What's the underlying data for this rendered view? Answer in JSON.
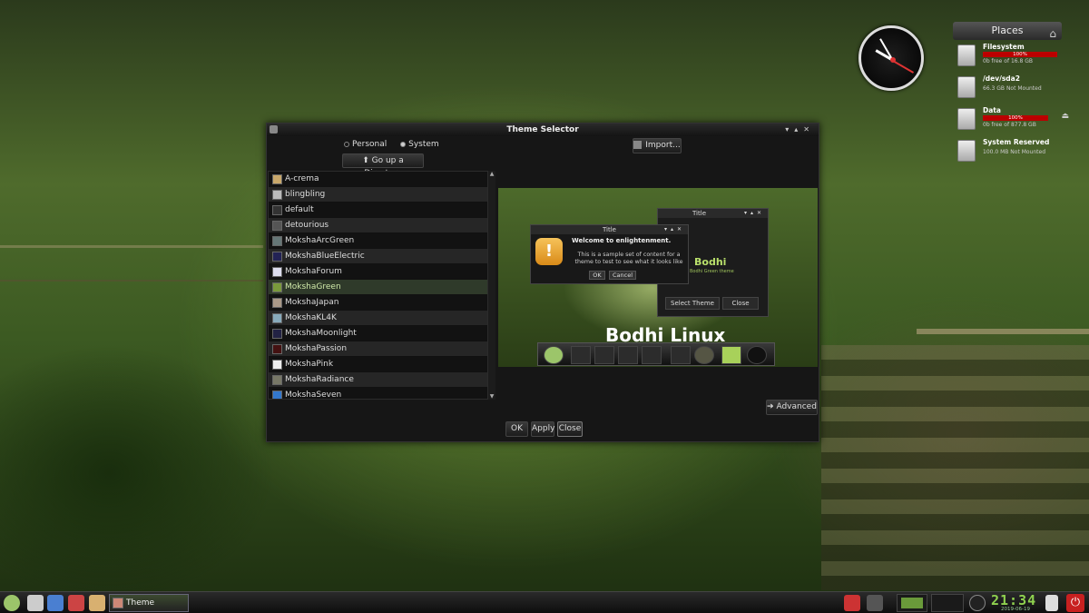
{
  "places": {
    "title": "Places",
    "drives": [
      {
        "name": "Filesystem",
        "usage": "100%",
        "info": "0b free of 16.8 GB"
      },
      {
        "name": "/dev/sda2",
        "usage": "",
        "info": "66.3 GB Not Mounted"
      },
      {
        "name": "Data",
        "usage": "100%",
        "info": "0b free of 877.8 GB"
      },
      {
        "name": "System Reserved",
        "usage": "",
        "info": "100.0 MB Not Mounted"
      }
    ]
  },
  "window": {
    "title": "Theme Selector",
    "radio_personal": "Personal",
    "radio_system": "System",
    "go_up": "Go up a Directory",
    "import": "Import...",
    "advanced": "Advanced",
    "ok": "OK",
    "apply": "Apply",
    "close": "Close",
    "themes": [
      "A-crema",
      "blingbling",
      "default",
      "detourious",
      "MokshaArcGreen",
      "MokshaBlueElectric",
      "MokshaForum",
      "MokshaGreen",
      "MokshaJapan",
      "MokshaKL4K",
      "MokshaMoonlight",
      "MokshaPassion",
      "MokshaPink",
      "MokshaRadiance",
      "MokshaSeven"
    ],
    "selected_theme": "MokshaGreen"
  },
  "preview": {
    "brand": "Bodhi Linux",
    "dialog_title": "Title",
    "dialog_heading": "Welcome to enlightenment.",
    "dialog_body": "This is a sample set of content for a theme to test to see what it looks like",
    "dialog_ok": "OK",
    "dialog_cancel": "Cancel",
    "theme_win_title": "Title",
    "theme_logo": "Bodhi",
    "theme_logo_sub": "Bodhi Green theme",
    "select_theme": "Select Theme",
    "theme_close": "Close"
  },
  "taskbar": {
    "task_label": "Theme Selector",
    "clock": "21:34",
    "date": "2019-06-19"
  },
  "colors": {
    "accent_green": "#8fd14f",
    "power_red": "#c82020"
  }
}
